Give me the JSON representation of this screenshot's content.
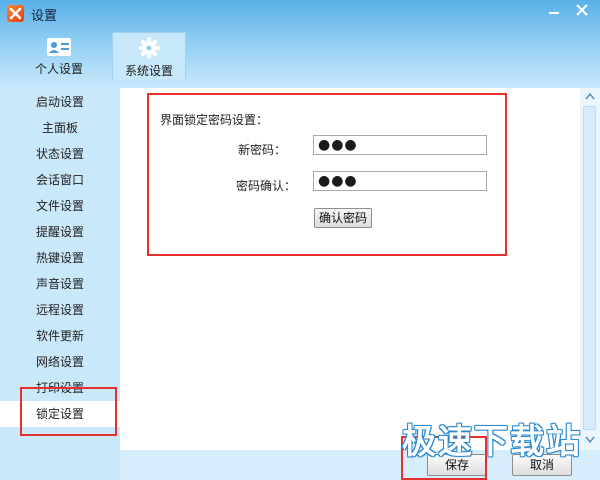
{
  "window": {
    "title": "设置",
    "app_icon": "app-logo-icon"
  },
  "top_tabs": [
    {
      "label": "个人设置",
      "icon": "id-card-icon",
      "active": false
    },
    {
      "label": "系统设置",
      "icon": "gear-icon",
      "active": true
    }
  ],
  "sidebar": {
    "items": [
      {
        "label": "启动设置"
      },
      {
        "label": "主面板"
      },
      {
        "label": "状态设置"
      },
      {
        "label": "会话窗口"
      },
      {
        "label": "文件设置"
      },
      {
        "label": "提醒设置"
      },
      {
        "label": "热键设置"
      },
      {
        "label": "声音设置"
      },
      {
        "label": "远程设置"
      },
      {
        "label": "软件更新"
      },
      {
        "label": "网络设置"
      },
      {
        "label": "打印设置"
      },
      {
        "label": "锁定设置",
        "active": true
      }
    ]
  },
  "lock_settings": {
    "section_title": "界面锁定密码设置：",
    "new_password_label": "新密码：",
    "new_password_value": "●●●",
    "confirm_password_label": "密码确认：",
    "confirm_password_value": "●●●",
    "confirm_button": "确认密码"
  },
  "footer": {
    "save": "保存",
    "cancel": "取消"
  },
  "watermark": "极速下载站",
  "colors": {
    "titlebar": "#59b0e8",
    "sidebar": "#c9e8fa",
    "highlight": "#e5302e"
  }
}
